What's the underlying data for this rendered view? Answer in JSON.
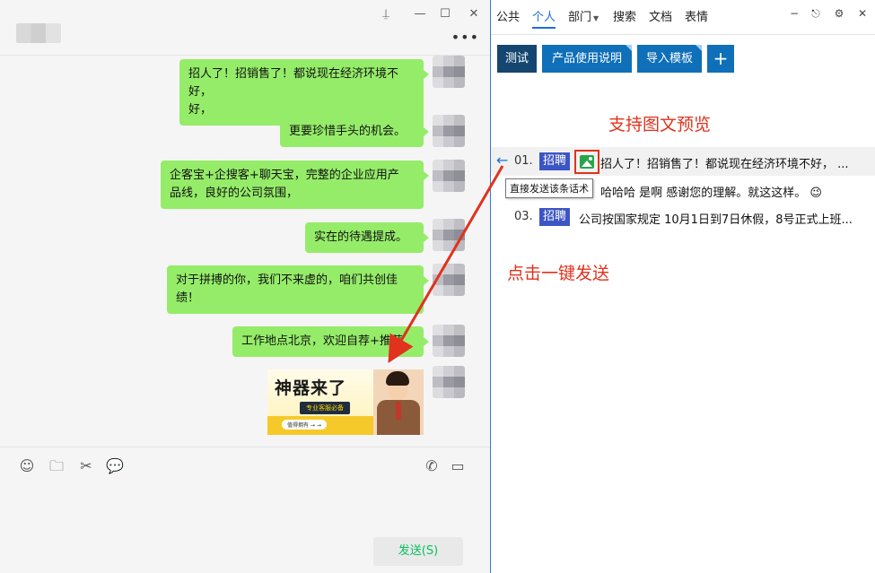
{
  "chat": {
    "window_controls": {
      "pin": "⍊",
      "minimize": "—",
      "maximize": "☐",
      "close": "✕"
    },
    "more": "•••",
    "messages": [
      {
        "text": "招人了！招销售了！都说现在经济环境不好，",
        "line2": "好，",
        "type": "text"
      },
      {
        "text": "更要珍惜手头的机会。",
        "type": "text"
      },
      {
        "text": "企客宝+企搜客+聊天宝，完整的企业应用产",
        "line2": "品线，良好的公司氛围，",
        "type": "text"
      },
      {
        "text": "实在的待遇提成。",
        "type": "text"
      },
      {
        "text": "对于拼搏的你，我们不来虚的，咱们共创佳",
        "line2": "绩！",
        "type": "text"
      },
      {
        "text": "工作地点北京，欢迎自荐+推荐",
        "type": "text"
      }
    ],
    "image_message": {
      "title": "神器来了",
      "subtitle": "专业客服必备",
      "footer": "值得拥有 → →"
    },
    "toolbar_icons": [
      "emoji-icon",
      "folder-icon",
      "scissors-icon",
      "chat-bubble-icon",
      "phone-icon",
      "video-icon"
    ],
    "send_label": "发送(S)"
  },
  "panel": {
    "tabs": [
      {
        "label": "公共",
        "active": false
      },
      {
        "label": "个人",
        "active": true
      },
      {
        "label": "部门",
        "active": false,
        "dropdown": true
      },
      {
        "label": "搜索",
        "active": false
      },
      {
        "label": "文档",
        "active": false
      },
      {
        "label": "表情",
        "active": false
      }
    ],
    "caret": "▼",
    "top_icons": {
      "minimize": "−",
      "exit": "⎋",
      "settings": "⚙",
      "close": "✕"
    },
    "categories": [
      "测试",
      "产品使用说明",
      "导入模板"
    ],
    "add_label": "+",
    "annotation_top": "支持图文预览",
    "annotation_bottom": "点击一键发送",
    "tooltip": "直接发送该条话术",
    "rows": [
      {
        "num": "01.",
        "badge": "招聘",
        "text": "招人了！招销售了！都说现在经济环境不好， ..."
      },
      {
        "num": "",
        "badge": "",
        "text": "哈哈哈  是啊   感谢您的理解。就这这样。 😉"
      },
      {
        "num": "03.",
        "badge": "招聘",
        "text": "公司按国家规定 10月1日到7日休假，8号正式上班..."
      }
    ],
    "back_arrow": "←"
  }
}
